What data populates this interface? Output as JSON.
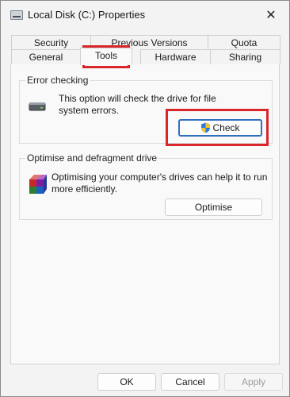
{
  "window": {
    "title": "Local Disk (C:) Properties",
    "close_symbol": "✕"
  },
  "tabs": {
    "row1": [
      "Security",
      "Previous Versions",
      "Quota"
    ],
    "row2": [
      "General",
      "Tools",
      "Hardware",
      "Sharing"
    ],
    "active": "Tools"
  },
  "error_checking": {
    "group_label": "Error checking",
    "description_line1": "This option will check the drive for file",
    "description_line2": "system errors.",
    "button_label": "Check",
    "icon": "drive-icon",
    "button_icon": "shield-icon"
  },
  "optimise": {
    "group_label": "Optimise and defragment drive",
    "description_line1": "Optimising your computer's drives can help it to run",
    "description_line2": "more efficiently.",
    "button_label": "Optimise",
    "icon": "defrag-icon"
  },
  "footer": {
    "ok": "OK",
    "cancel": "Cancel",
    "apply": "Apply"
  },
  "colors": {
    "highlight": "#d9262b",
    "primary_border": "#2f6fbd"
  }
}
